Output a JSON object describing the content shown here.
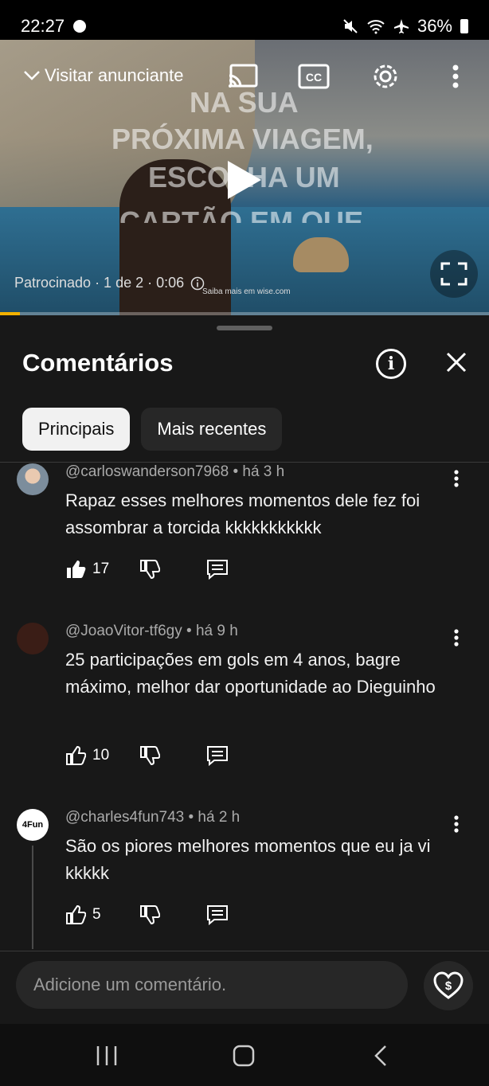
{
  "status_bar": {
    "time": "22:27",
    "battery": "36%"
  },
  "video": {
    "visit_label": "Visitar anunciante",
    "ad_text": [
      "NA SUA",
      "PRÓXIMA VIAGEM,",
      "ESCOLHA UM",
      "CARTÃO EM QUE"
    ],
    "sponsor_label": "Patrocinado · 1 de 2 · 0:06",
    "learn_more": "Saiba mais em wise.com",
    "progress": 0.04,
    "accent": "#f2b100"
  },
  "comments_panel": {
    "title": "Comentários",
    "chips": [
      {
        "label": "Principais",
        "active": true
      },
      {
        "label": "Mais recentes",
        "active": false
      }
    ],
    "comments": [
      {
        "author": "@carloswanderson7968 • há 3 h",
        "text": "Rapaz esses melhores momentos dele fez foi assombrar a torcida kkkkkkkkkkk",
        "likes": "17",
        "liked": true
      },
      {
        "author": "@JoaoVitor-tf6gy • há 9 h",
        "text": "25 participações em gols em 4 anos, bagre máximo, melhor dar oportunidade ao Dieguinho",
        "likes": "10",
        "liked": false
      },
      {
        "author": "@charles4fun743 • há 2 h",
        "text": "São os piores melhores momentos que eu ja vi kkkkk",
        "likes": "5",
        "liked": false,
        "avatar_text": "4Fun"
      }
    ],
    "add_placeholder": "Adicione um comentário."
  }
}
